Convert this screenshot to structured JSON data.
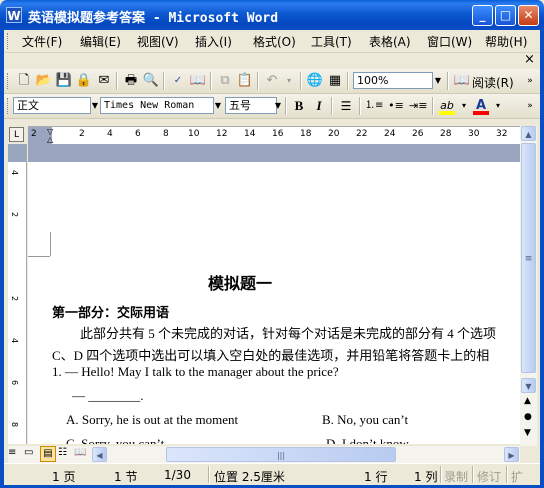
{
  "window": {
    "title": "英语模拟题参考答案 - Microsoft Word",
    "app_icon": "W",
    "minimize": "_",
    "maximize": "□",
    "close": "✕"
  },
  "menu": {
    "items": [
      "文件(F)",
      "编辑(E)",
      "视图(V)",
      "插入(I)",
      "格式(O)",
      "工具(T)",
      "表格(A)",
      "窗口(W)",
      "帮助(H)"
    ],
    "close_doc": "×"
  },
  "standard_toolbar": {
    "zoom": "100%",
    "read_label": "阅读(R)",
    "icons": [
      "new-icon",
      "open-icon",
      "save-icon",
      "permission-icon",
      "email-icon",
      "print-icon",
      "print-preview-icon",
      "spelling-icon",
      "research-icon",
      "copy-icon",
      "paste-icon",
      "undo-icon",
      "hyperlink-icon",
      "table-icon"
    ]
  },
  "formatting_toolbar": {
    "style": "正文",
    "font": "Times New Roman",
    "size": "五号",
    "bold": "B",
    "italic": "I",
    "highlight": "ab",
    "font_color": "A"
  },
  "ruler": {
    "h_numbers": [
      "2",
      "2",
      "4",
      "6",
      "8",
      "10",
      "12",
      "14",
      "16",
      "18",
      "20",
      "22",
      "24",
      "26",
      "28",
      "30",
      "32"
    ],
    "v_numbers": [
      "4",
      "2",
      "2",
      "4",
      "6",
      "8",
      "10",
      "12"
    ]
  },
  "document": {
    "heading": "模拟题一",
    "section_title": "第一部分：交际用语",
    "para1": "此部分共有 5 个未完成的对话，针对每个对话是未完成的部分有 4 个选项",
    "para2": "C、D 四个选项中选出可以填入空白处的最佳选项，并用铅笔将答题卡上的相",
    "q1": "1. — Hello! May I talk to the manager about the price?",
    "blank": "— ________.",
    "optA": "A. Sorry, he is out at the moment",
    "optB": "B. No, you can’t",
    "optC": "C. Sorry, you can’t",
    "optD": "D. I don’t know"
  },
  "status": {
    "page": "1 页",
    "section": "1 节",
    "pages": "1/30",
    "position": "位置 2.5厘米",
    "line": "1 行",
    "column": "1 列",
    "rec": "录制",
    "trk": "修订",
    "ext": "扩"
  },
  "colors": {
    "titlebar": "#0a5fd8",
    "highlight_color": "#ffff00",
    "font_color_bar": "#ff0000"
  }
}
